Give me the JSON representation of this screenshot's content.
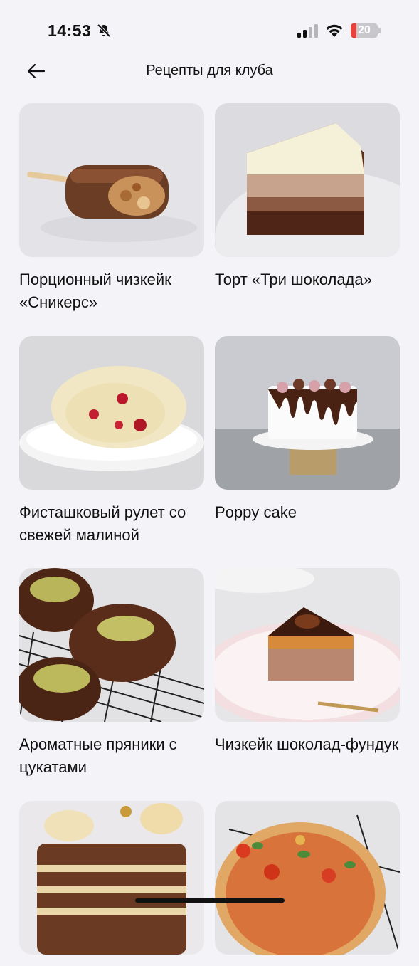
{
  "status_bar": {
    "time": "14:53",
    "battery": "20",
    "battery_level": 0.2,
    "bell_icon": "bell-slash-icon",
    "signal_icon": "cellular-signal-icon",
    "wifi_icon": "wifi-icon"
  },
  "header": {
    "title": "Рецепты для клуба",
    "back_icon": "arrow-left-icon"
  },
  "recipes": [
    {
      "title": "Порционный чизкейк «Сникерс»"
    },
    {
      "title": "Торт «Три шоколада»"
    },
    {
      "title": "Фисташковый рулет со свежей малиной"
    },
    {
      "title": "Poppy cake"
    },
    {
      "title": "Ароматные пряники с цукатами"
    },
    {
      "title": "Чизкейк шоколад-фундук"
    },
    {
      "title": ""
    },
    {
      "title": ""
    }
  ]
}
